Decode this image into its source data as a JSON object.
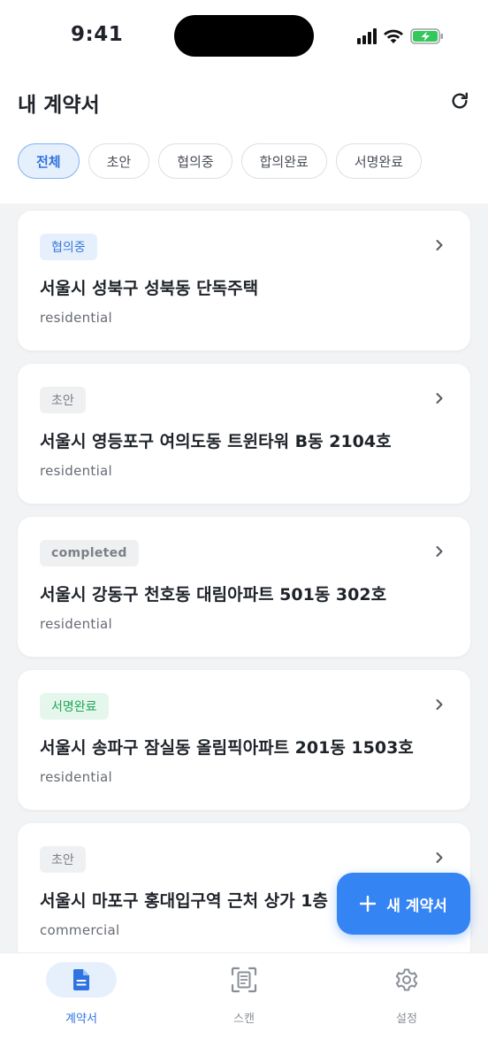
{
  "status_bar": {
    "time": "9:41"
  },
  "header": {
    "title": "내 계약서",
    "filters": [
      {
        "label": "전체",
        "active": true
      },
      {
        "label": "초안",
        "active": false
      },
      {
        "label": "협의중",
        "active": false
      },
      {
        "label": "합의완료",
        "active": false
      },
      {
        "label": "서명완료",
        "active": false
      }
    ]
  },
  "contracts": [
    {
      "status": "협의중",
      "status_color": "#3a78d8",
      "title": "서울시 성북구 성북동 단독주택",
      "type": "residential"
    },
    {
      "status": "초안",
      "status_color": "#7b8088",
      "title": "서울시 영등포구 여의도동 트윈타워 B동 2104호",
      "type": "residential"
    },
    {
      "status": "completed",
      "status_color": "#7b8088",
      "title": "서울시 강동구 천호동 대림아파트 501동 302호",
      "type": "residential"
    },
    {
      "status": "서명완료",
      "status_color": "#20a558",
      "title": "서울시 송파구 잠실동 올림픽아파트 201동 1503호",
      "type": "residential"
    },
    {
      "status": "초안",
      "status_color": "#7b8088",
      "title": "서울시 마포구 홍대입구역 근처 상가 1층",
      "type": "commercial"
    }
  ],
  "fab": {
    "label": "새 계약서",
    "icon": "plus-icon"
  },
  "tabbar": {
    "items": [
      {
        "label": "계약서",
        "icon": "document-icon",
        "active": true
      },
      {
        "label": "스캔",
        "icon": "scan-icon",
        "active": false
      },
      {
        "label": "설정",
        "icon": "gear-icon",
        "active": false
      }
    ]
  },
  "colors": {
    "accent": "#3584f3",
    "active_tab": "#2f73e0"
  }
}
